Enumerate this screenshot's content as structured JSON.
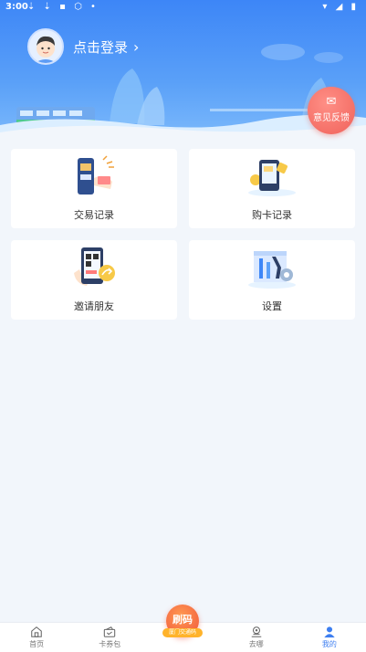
{
  "status_bar": {
    "time": "3:00",
    "left_icons": "⇣ ⇣ ▪ ⬡ •",
    "right_icons": "▾ ◢ ▮"
  },
  "profile": {
    "login_label": "点击登录",
    "chevron": "›"
  },
  "feedback": {
    "label": "意见反馈",
    "icon": "mail-icon"
  },
  "menu": [
    {
      "label": "交易记录",
      "icon": "transaction-record-icon"
    },
    {
      "label": "购卡记录",
      "icon": "card-purchase-record-icon"
    },
    {
      "label": "邀请朋友",
      "icon": "invite-friend-icon"
    },
    {
      "label": "设置",
      "icon": "settings-icon"
    }
  ],
  "bottom_nav": {
    "items": [
      {
        "label": "首页",
        "icon": "home-icon"
      },
      {
        "label": "卡券包",
        "icon": "card-wallet-icon"
      },
      {
        "label": "去哪",
        "icon": "location-icon"
      },
      {
        "label": "我的",
        "icon": "user-icon",
        "active": true
      }
    ],
    "center": {
      "label": "刷码",
      "sub_label": "厦门交通码"
    }
  },
  "colors": {
    "header_blue": "#3d86f7",
    "accent_active": "#3d7ef0",
    "feedback_red": "#f0625a",
    "pay_orange": "#f0543b"
  }
}
